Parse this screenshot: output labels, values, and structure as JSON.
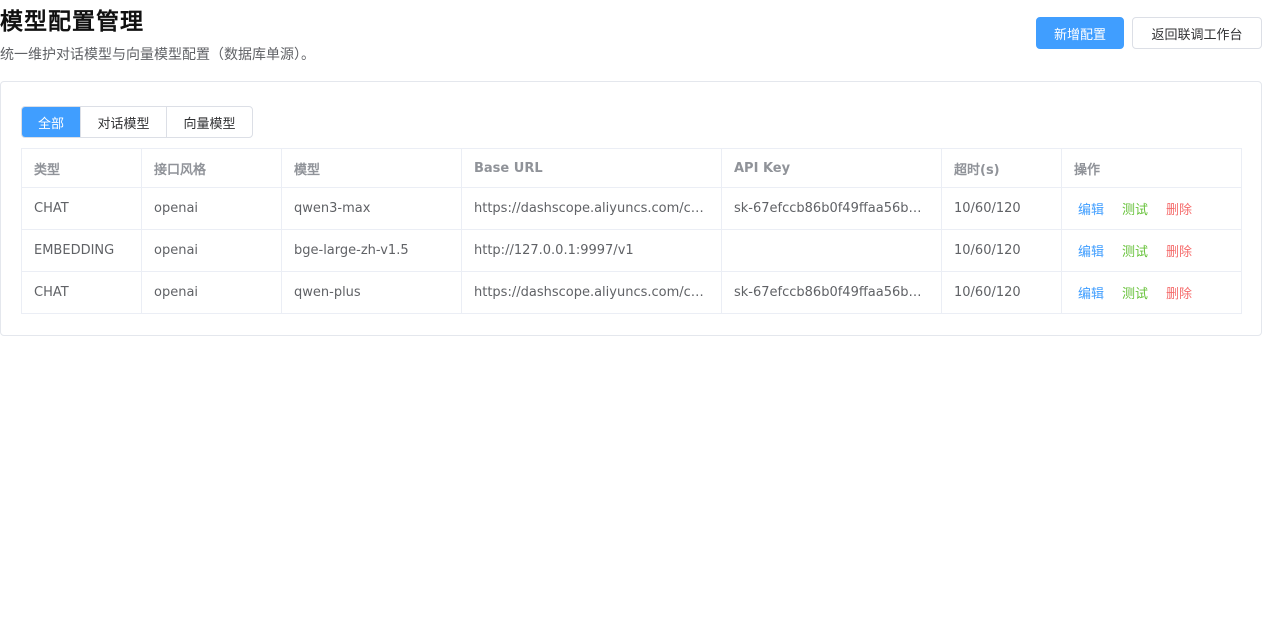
{
  "header": {
    "title": "模型配置管理",
    "subtitle": "统一维护对话模型与向量模型配置（数据库单源）。",
    "add_button": "新增配置",
    "back_button": "返回联调工作台"
  },
  "tabs": [
    {
      "label": "全部",
      "active": true
    },
    {
      "label": "对话模型",
      "active": false
    },
    {
      "label": "向量模型",
      "active": false
    }
  ],
  "table": {
    "columns": [
      "类型",
      "接口风格",
      "模型",
      "Base URL",
      "API Key",
      "超时(s)",
      "操作"
    ],
    "rows": [
      {
        "type": "CHAT",
        "style": "openai",
        "model": "qwen3-max",
        "base_url": "https://dashscope.aliyuncs.com/c…",
        "api_key": "sk-67efccb86b0f49ffaa56be…",
        "timeout": "10/60/120"
      },
      {
        "type": "EMBEDDING",
        "style": "openai",
        "model": "bge-large-zh-v1.5",
        "base_url": "http://127.0.0.1:9997/v1",
        "api_key": "",
        "timeout": "10/60/120"
      },
      {
        "type": "CHAT",
        "style": "openai",
        "model": "qwen-plus",
        "base_url": "https://dashscope.aliyuncs.com/c…",
        "api_key": "sk-67efccb86b0f49ffaa56be…",
        "timeout": "10/60/120"
      }
    ],
    "actions": {
      "edit": "编辑",
      "test": "测试",
      "delete": "删除"
    }
  },
  "colors": {
    "primary": "#409eff",
    "success": "#67c23a",
    "danger": "#f56c6c"
  }
}
